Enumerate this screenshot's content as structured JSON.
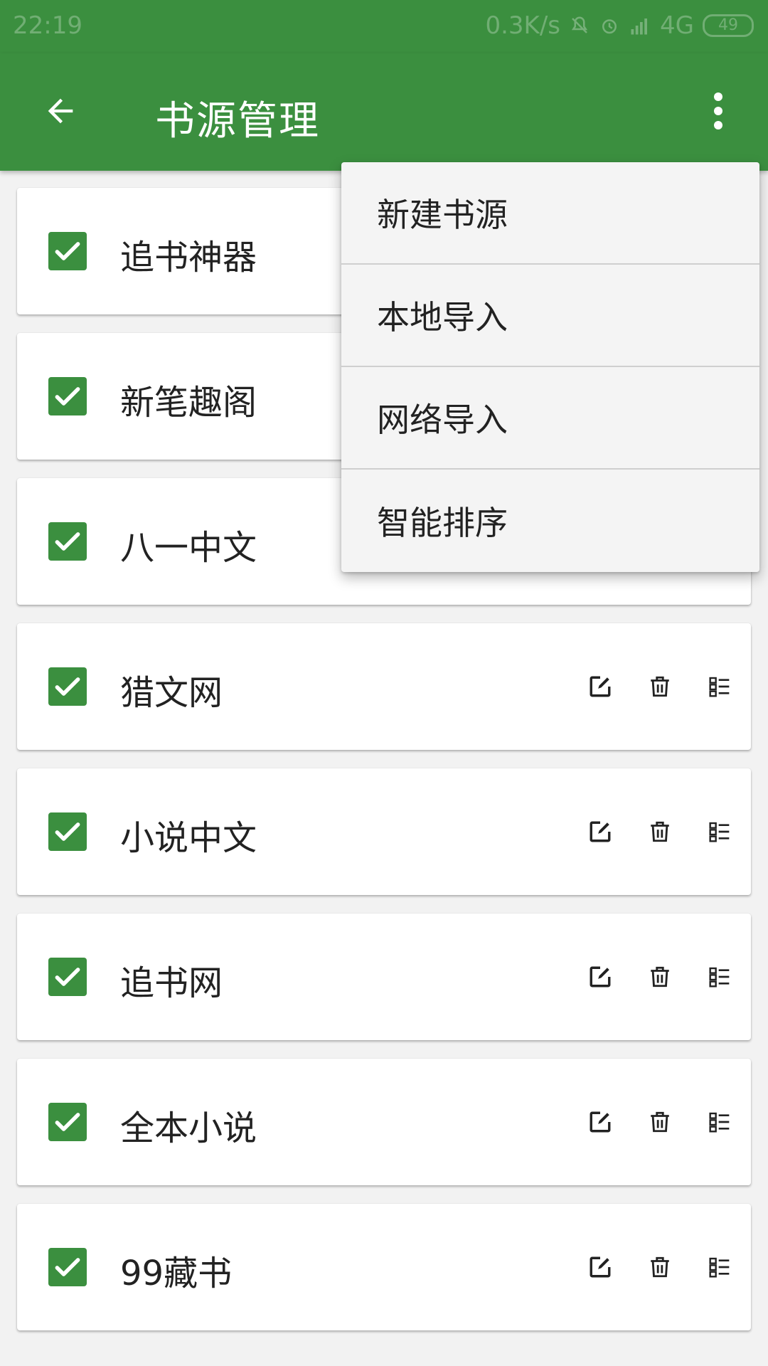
{
  "status_bar": {
    "time": "22:19",
    "network_speed": "0.3K/s",
    "signal_label": "4G",
    "battery": "49"
  },
  "app_bar": {
    "title": "书源管理",
    "back_icon": "arrow-left-icon",
    "more_icon": "more-vertical-icon"
  },
  "menu": {
    "items": [
      {
        "label": "新建书源"
      },
      {
        "label": "本地导入"
      },
      {
        "label": "网络导入"
      },
      {
        "label": "智能排序"
      }
    ]
  },
  "sources": [
    {
      "name": "追书神器",
      "checked": true
    },
    {
      "name": "新笔趣阁",
      "checked": true
    },
    {
      "name": "八一中文",
      "checked": true
    },
    {
      "name": "猎文网",
      "checked": true
    },
    {
      "name": "小说中文",
      "checked": true
    },
    {
      "name": "追书网",
      "checked": true
    },
    {
      "name": "全本小说",
      "checked": true
    },
    {
      "name": "99藏书",
      "checked": true
    }
  ],
  "colors": {
    "primary": "#3b8f3f",
    "checkbox": "#3b8f3f"
  }
}
